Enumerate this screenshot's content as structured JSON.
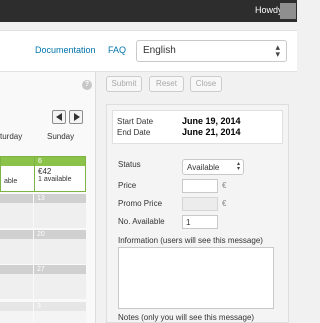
{
  "adminbar": {
    "greeting": "Howdy,"
  },
  "topbar": {
    "documentation": "Documentation",
    "faq": "FAQ",
    "language": "English"
  },
  "calendar": {
    "days": [
      "turday",
      "Sunday"
    ],
    "row1": {
      "sat_avail": "able",
      "sun_num": "6",
      "sun_price": "€42",
      "sun_avail": "1 available"
    },
    "row_nums": [
      "13",
      "20",
      "27",
      "3"
    ]
  },
  "actions": {
    "submit": "Submit",
    "reset": "Reset",
    "close": "Close"
  },
  "dates": {
    "start_label": "Start Date",
    "start_value": "June 19, 2014",
    "end_label": "End Date",
    "end_value": "June 21, 2014"
  },
  "form": {
    "status_label": "Status",
    "status_value": "Available",
    "price_label": "Price",
    "price_value": "",
    "promo_label": "Promo Price",
    "promo_value": "",
    "currency": "€",
    "available_label": "No. Available",
    "available_value": "1",
    "info_label": "Information (users will see this message)",
    "notes_label": "Notes (only you will see this message)"
  },
  "icons": {
    "help": "help-icon",
    "prev": "arrow-left-icon",
    "next": "arrow-right-icon",
    "dropdown": "chevron-down-icon"
  }
}
